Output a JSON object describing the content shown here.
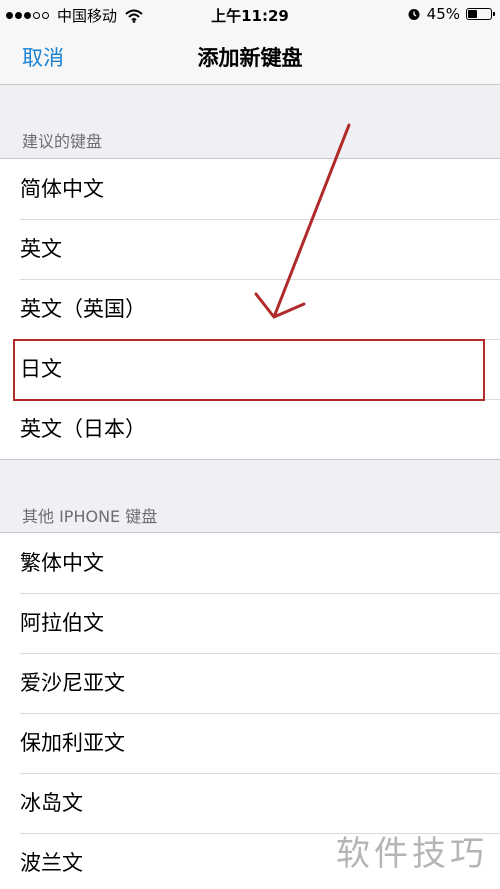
{
  "status_bar": {
    "carrier": "中国移动",
    "time": "上午11:29",
    "battery": "45%",
    "battery_level": 0.45,
    "icons": [
      "signal-icon",
      "wifi-icon",
      "alarm-icon",
      "battery-icon"
    ]
  },
  "nav": {
    "cancel": "取消",
    "title": "添加新键盘"
  },
  "suggested": {
    "header": "建议的键盘",
    "items": [
      "简体中文",
      "英文",
      "英文（英国）",
      "日文",
      "英文（日本）"
    ]
  },
  "other": {
    "header": "其他 IPHONE 键盘",
    "items": [
      "繁体中文",
      "阿拉伯文",
      "爱沙尼亚文",
      "保加利亚文",
      "冰岛文",
      "波兰文"
    ]
  },
  "annotation": {
    "highlight_color": "#b02a2a"
  },
  "watermark": "软件技巧",
  "colors": {
    "accent": "#1b82d1",
    "background": "#efeff4"
  }
}
